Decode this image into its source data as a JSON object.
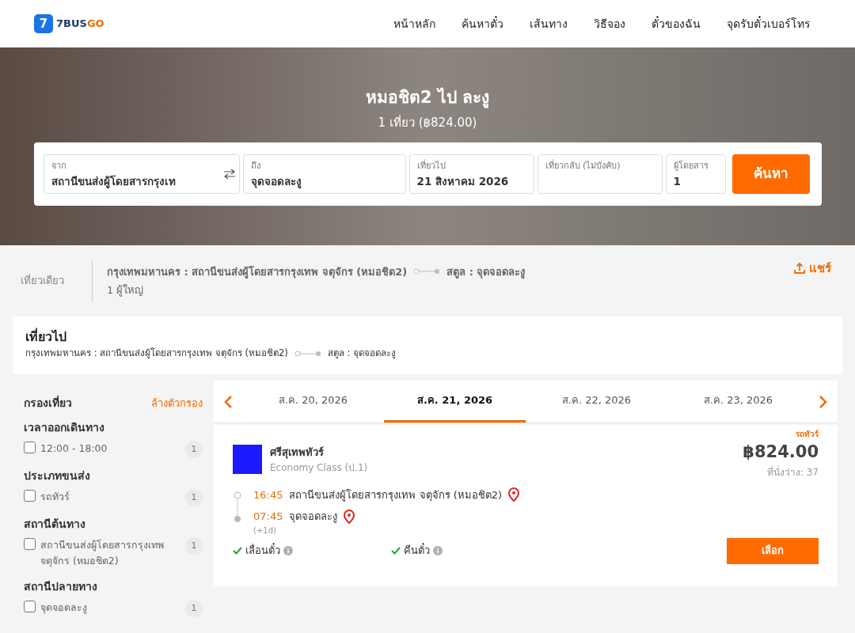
{
  "header": {
    "logo_text_a": "7BUS",
    "logo_text_b": "GO",
    "logo_mark": "7",
    "nav": [
      {
        "label": "หน้าหลัก"
      },
      {
        "label": "ค้นหาตั๋ว"
      },
      {
        "label": "เส้นทาง"
      },
      {
        "label": "วิธีจอง"
      },
      {
        "label": "ตั๋วของฉัน"
      },
      {
        "label": "จุดรับตั๋วเบอร์โทร"
      }
    ]
  },
  "hero": {
    "title": "หมอชิต2 ไป ละงู",
    "subtitle": "1 เที่ยว (฿824.00)"
  },
  "search_form": {
    "fields": [
      {
        "label": "จาก",
        "value": "สถานีขนส่งผู้โดยสารกรุงเท",
        "swap": true
      },
      {
        "label": "ถึง",
        "value": "จุดจอดละงู",
        "swap": false
      },
      {
        "label": "เที่ยวไป",
        "value": "21 สิงหาคม 2026",
        "swap": false
      },
      {
        "label": "เที่ยวกลับ (ไม่บังคับ)",
        "swap": false
      },
      {
        "label": "ผู้โดยสาร",
        "value": "1",
        "swap": false
      }
    ],
    "button": "ค้นหา"
  },
  "trip_summary": {
    "type": "เที่ยวเดียว",
    "from": "กรุงเทพมหานคร : สถานีขนส่งผู้โดยสารกรุงเทพ จตุจักร (หมอชิต2)",
    "to": "สตูล : จุดจอดละงู",
    "passengers": "1 ผู้ใหญ่",
    "share": "แชร์"
  },
  "outbound": {
    "title": "เที่ยวไป",
    "from": "กรุงเทพมหานคร : สถานีขนส่งผู้โดยสารกรุงเทพ จตุจักร (หมอชิต2)",
    "to": "สตูล : จุดจอดละงู"
  },
  "filters": {
    "title": "กรองเที่ยว",
    "clear": "ล้างตัวกรอง",
    "groups": [
      {
        "title": "เวลาออกเดินทาง",
        "options": [
          {
            "label": "12:00 - 18:00",
            "count": "1",
            "checked": false
          }
        ]
      },
      {
        "title": "ประเภทขนส่ง",
        "options": [
          {
            "label": "รถทัวร์",
            "count": "1",
            "checked": false
          }
        ]
      },
      {
        "title": "สถานีต้นทาง",
        "options": [
          {
            "label": "สถานีขนส่งผู้โดยสารกรุงเทพ จตุจักร (หมอชิต2)",
            "count": "1",
            "checked": false
          }
        ]
      },
      {
        "title": "สถานีปลายทาง",
        "options": [
          {
            "label": "จุดจอดละงู",
            "count": "1",
            "checked": false
          }
        ]
      }
    ]
  },
  "date_tabs": [
    {
      "label": "ส.ค. 20, 2026",
      "selected": false
    },
    {
      "label": "ส.ค. 21, 2026",
      "selected": true
    },
    {
      "label": "ส.ค. 22, 2026",
      "selected": false
    },
    {
      "label": "ส.ค. 23, 2026",
      "selected": false
    }
  ],
  "trips": [
    {
      "tag": "รถทัวร์",
      "operator": "ศรีสุเทพทัวร์",
      "class": "Economy Class (ป.1)",
      "price": "฿824.00",
      "seats": "ที่นั่งว่าง: 37",
      "departure_time": "16:45",
      "departure_station": "สถานีขนส่งผู้โดยสารกรุงเทพ จตุจักร (หมอชิต2)",
      "arrival_time": "07:45",
      "arrival_station": "จุดจอดละงู",
      "day_offset": "(+1d)",
      "features": [
        {
          "label": "เลื่อนตั๋ว",
          "available": true
        },
        {
          "label": "คืนตั๋ว",
          "available": true
        }
      ],
      "button": "เลือก"
    }
  ]
}
